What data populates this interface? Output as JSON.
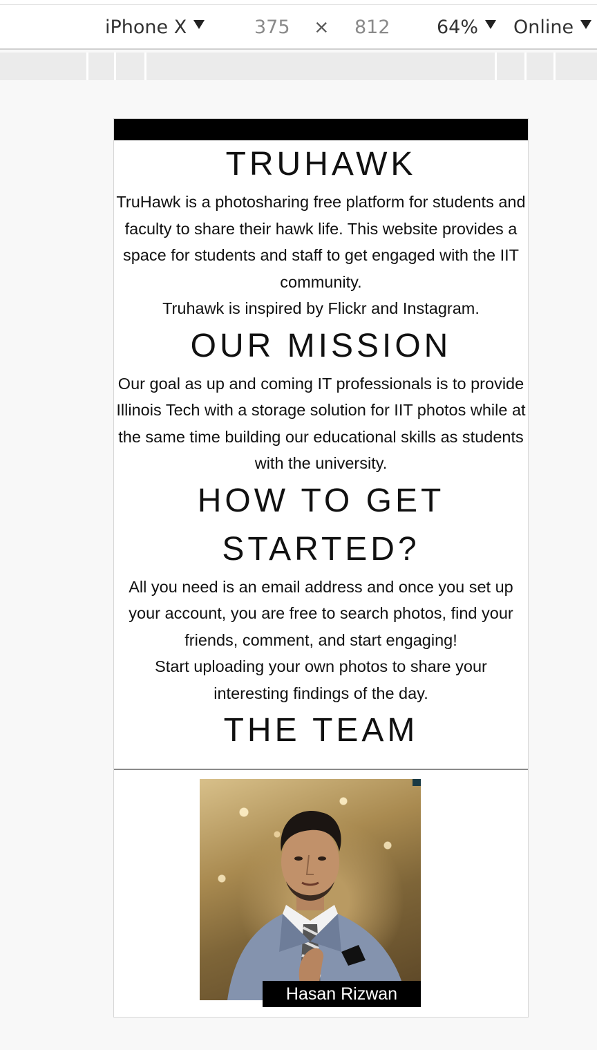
{
  "toolbar": {
    "device": "iPhone X",
    "width": "375",
    "times": "×",
    "height": "812",
    "zoom": "64%",
    "network": "Online"
  },
  "page": {
    "title": "TRUHAWK",
    "intro": [
      "TruHawk is a photosharing free platform for students and faculty to share their hawk life. This website provides a space for students and staff to get engaged with the IIT community.",
      "Truhawk is inspired by Flickr and Instagram."
    ],
    "mission_heading": "OUR MISSION",
    "mission_text": "Our goal as up and coming IT professionals is to provide Illinois Tech with a storage solution for IIT photos while at the same time building our educational skills as students with the university.",
    "start_heading": "HOW TO GET STARTED?",
    "start_text": [
      "All you need is an email address and once you set up your account, you are free to search photos, find your friends, comment, and start engaging!",
      "Start uploading your own photos to share your interesting findings of the day."
    ],
    "team_heading": "THE TEAM",
    "team": [
      {
        "name": "Hasan Rizwan"
      }
    ]
  },
  "colors": {
    "header_bar": "#000000",
    "caption_bg": "#000000",
    "caption_text": "#ffffff"
  }
}
